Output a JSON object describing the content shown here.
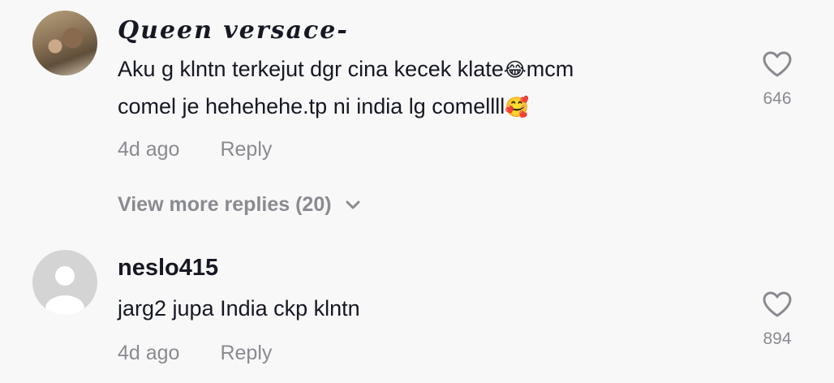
{
  "comments": [
    {
      "username": "Queen versace-",
      "text_part1": "Aku g klntn terkejut dgr cina kecek klate",
      "emoji1": "😂",
      "text_part2": "mcm",
      "text_line2": "comel je hehehehe.tp ni india lg comellll",
      "emoji2": "🥰",
      "time": "4d ago",
      "reply_label": "Reply",
      "like_count": "646",
      "avatar": "user-photo"
    },
    {
      "username": "neslo415",
      "text": "jarg2 jupa India ckp klntn",
      "time": "4d ago",
      "reply_label": "Reply",
      "like_count": "894",
      "avatar": "default-avatar"
    }
  ],
  "view_more": {
    "label": "View more replies (20)",
    "icon": "chevron-down-icon"
  },
  "colors": {
    "background": "#f8f8f8",
    "text": "#161823",
    "secondary": "#8a8b91"
  }
}
